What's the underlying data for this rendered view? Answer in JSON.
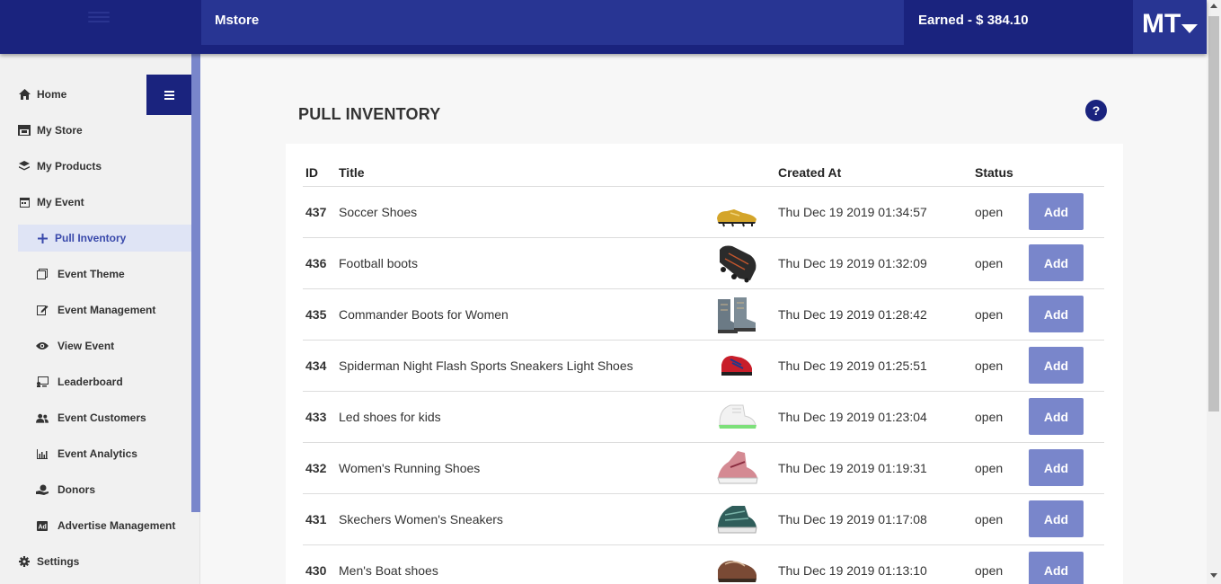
{
  "header": {
    "store_name": "Mstore",
    "earned": "Earned - $ 384.10",
    "avatar_initials": "MT",
    "brand_color": "#1a237e",
    "accent_color": "#283593"
  },
  "sidebar": {
    "items": [
      {
        "label": "Home",
        "icon": "home-icon"
      },
      {
        "label": "My Store",
        "icon": "store-icon"
      },
      {
        "label": "My Products",
        "icon": "layers-icon"
      },
      {
        "label": "My Event",
        "icon": "calendar-icon"
      },
      {
        "label": "Pull Inventory",
        "icon": "plus-icon"
      },
      {
        "label": "Event Theme",
        "icon": "clone-icon"
      },
      {
        "label": "Event Management",
        "icon": "edit-icon"
      },
      {
        "label": "View Event",
        "icon": "eye-icon"
      },
      {
        "label": "Leaderboard",
        "icon": "leaderboard-icon"
      },
      {
        "label": "Event Customers",
        "icon": "users-icon"
      },
      {
        "label": "Event Analytics",
        "icon": "bar-chart-icon"
      },
      {
        "label": "Donors",
        "icon": "donate-icon"
      },
      {
        "label": "Advertise Management",
        "icon": "ad-icon"
      },
      {
        "label": "Settings",
        "icon": "gear-icon"
      }
    ],
    "active_item": "Pull Inventory"
  },
  "main": {
    "title": "PULL INVENTORY",
    "help_label": "?",
    "table": {
      "headers": {
        "id": "ID",
        "title": "Title",
        "created": "Created At",
        "status": "Status"
      },
      "add_label": "Add",
      "rows": [
        {
          "id": "437",
          "title": "Soccer Shoes",
          "created": "Thu Dec 19 2019 01:34:57",
          "status": "open",
          "image": "gold-soccer-cleat"
        },
        {
          "id": "436",
          "title": "Football boots",
          "created": "Thu Dec 19 2019 01:32:09",
          "status": "open",
          "image": "black-football-boot"
        },
        {
          "id": "435",
          "title": "Commander Boots for Women",
          "created": "Thu Dec 19 2019 01:28:42",
          "status": "open",
          "image": "grey-women-boots"
        },
        {
          "id": "434",
          "title": "Spiderman Night Flash Sports Sneakers Light Shoes",
          "created": "Thu Dec 19 2019 01:25:51",
          "status": "open",
          "image": "red-kids-sneaker"
        },
        {
          "id": "433",
          "title": "Led shoes for kids",
          "created": "Thu Dec 19 2019 01:23:04",
          "status": "open",
          "image": "white-led-shoe"
        },
        {
          "id": "432",
          "title": "Women's Running Shoes",
          "created": "Thu Dec 19 2019 01:19:31",
          "status": "open",
          "image": "pink-running-shoe"
        },
        {
          "id": "431",
          "title": "Skechers Women's Sneakers",
          "created": "Thu Dec 19 2019 01:17:08",
          "status": "open",
          "image": "teal-sneaker"
        },
        {
          "id": "430",
          "title": "Men's Boat shoes",
          "created": "Thu Dec 19 2019 01:13:10",
          "status": "open",
          "image": "brown-boat-shoe"
        }
      ]
    }
  }
}
